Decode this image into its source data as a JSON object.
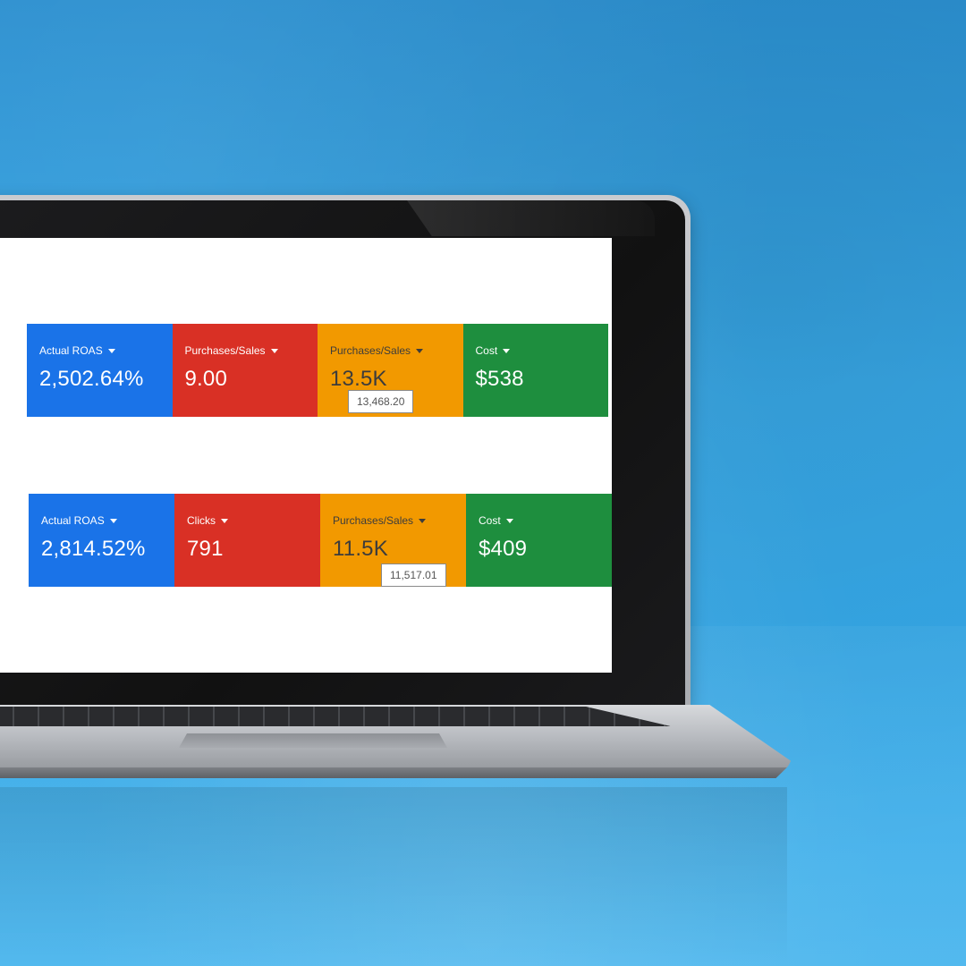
{
  "colors": {
    "blue": "#1a73e8",
    "red": "#d93025",
    "yellow": "#f29900",
    "green": "#1e8e3e",
    "background": "#37a6e4"
  },
  "scorecards_top": [
    {
      "label": "Actual ROAS",
      "value": "2,502.64%",
      "color": "blue"
    },
    {
      "label": "Purchases/Sales",
      "value": "9.00",
      "color": "red"
    },
    {
      "label": "Purchases/Sales",
      "value": "13.5K",
      "color": "yellow",
      "tooltip": "13,468.20"
    },
    {
      "label": "Cost",
      "value": "$538",
      "color": "green"
    }
  ],
  "scorecards_bottom": [
    {
      "label": "Actual ROAS",
      "value": "2,814.52%",
      "color": "blue"
    },
    {
      "label": "Clicks",
      "value": "791",
      "color": "red"
    },
    {
      "label": "Purchases/Sales",
      "value": "11.5K",
      "color": "yellow",
      "tooltip": "11,517.01"
    },
    {
      "label": "Cost",
      "value": "$409",
      "color": "green"
    }
  ]
}
